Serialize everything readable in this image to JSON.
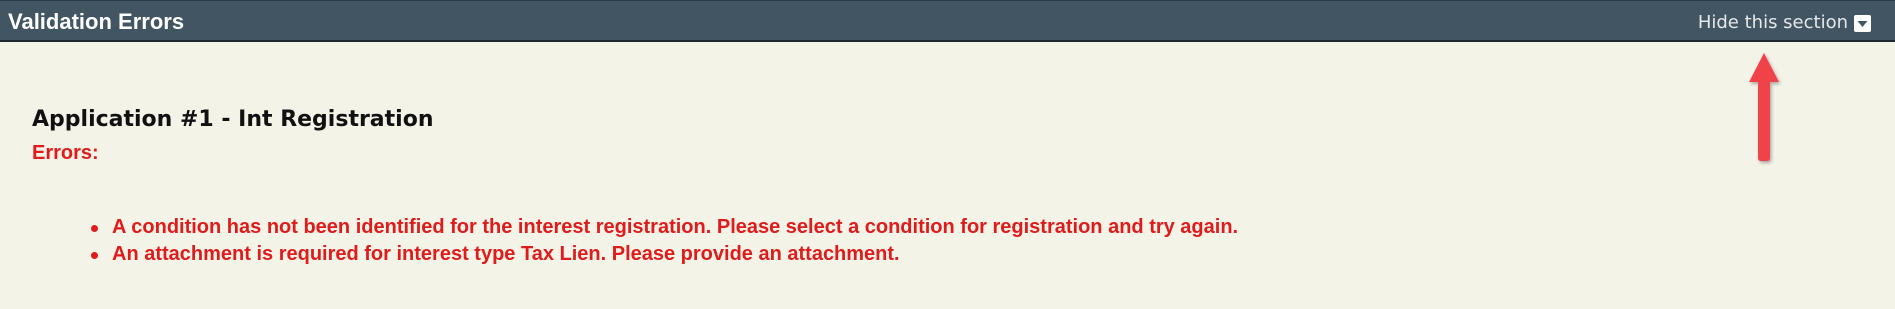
{
  "header": {
    "title": "Validation Errors",
    "toggle_label": "Hide this section",
    "toggle_icon": "chevron-down-icon"
  },
  "application": {
    "title": "Application #1 - Int Registration",
    "errors_label": "Errors:",
    "errors": [
      "A condition has not been identified for the interest registration. Please select a condition for registration and try again.",
      "An attachment is required for interest type Tax Lien. Please provide an attachment."
    ]
  },
  "annotation": {
    "icon": "up-arrow-icon",
    "color": "#f0434a"
  },
  "colors": {
    "header_bg": "#415563",
    "panel_bg": "#f4f3e8",
    "error_text": "#e01b1b"
  }
}
